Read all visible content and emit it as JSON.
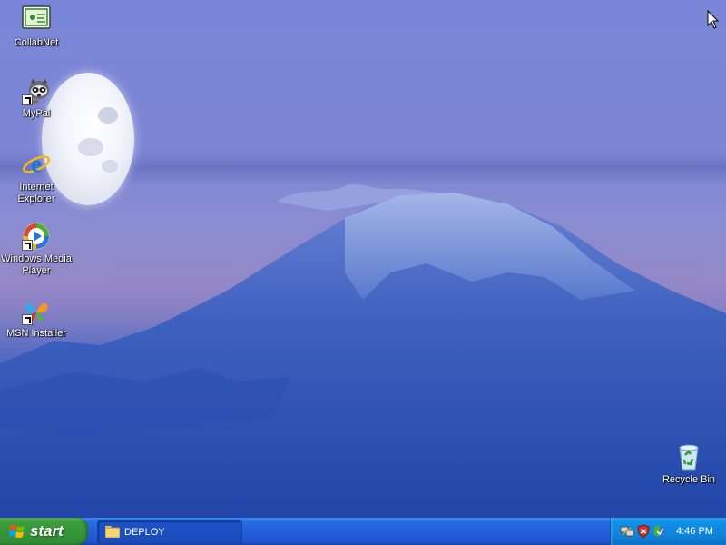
{
  "desktop": {
    "icons": [
      {
        "label": "CollabNet"
      },
      {
        "label": "MyPal"
      },
      {
        "label": "Internet Explorer"
      },
      {
        "label": "Windows Media Player"
      },
      {
        "label": "MSN Installer"
      },
      {
        "label": "Recycle Bin"
      }
    ]
  },
  "taskbar": {
    "start_label": "start",
    "tasks": [
      {
        "label": "DEPLOY"
      }
    ],
    "tray": {
      "icons": [
        "network-icon",
        "security-shield-icon",
        "update-icon"
      ],
      "clock": "4:46 PM"
    }
  },
  "colors": {
    "taskbar": "#245edb",
    "start_button": "#3c9e3c",
    "tray": "#0f85db"
  }
}
